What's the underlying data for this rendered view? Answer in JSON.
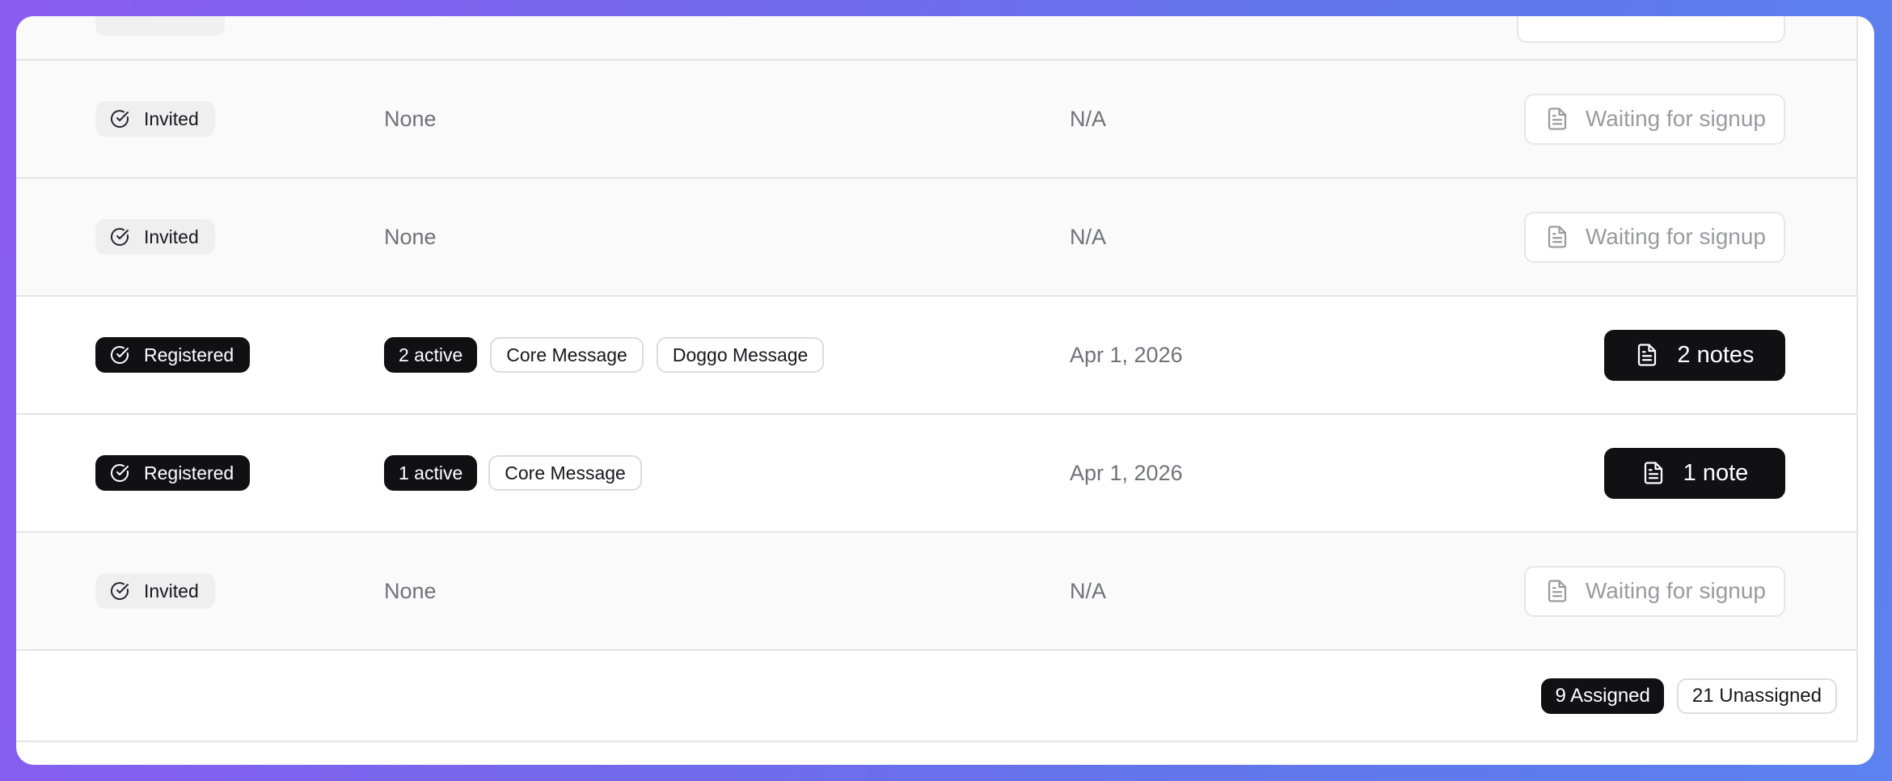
{
  "rows": [
    {
      "status": "Invited",
      "subscriptions": "None",
      "date": "N/A",
      "action": "Waiting for signup"
    },
    {
      "status": "Invited",
      "subscriptions": "None",
      "date": "N/A",
      "action": "Waiting for signup"
    },
    {
      "status": "Registered",
      "active_count": "2 active",
      "messages": [
        "Core Message",
        "Doggo Message"
      ],
      "date": "Apr 1, 2026",
      "action": "2 notes"
    },
    {
      "status": "Registered",
      "active_count": "1 active",
      "messages": [
        "Core Message"
      ],
      "date": "Apr 1, 2026",
      "action": "1 note"
    },
    {
      "status": "Invited",
      "subscriptions": "None",
      "date": "N/A",
      "action": "Waiting for signup"
    }
  ],
  "footer": {
    "assigned": "9 Assigned",
    "unassigned": "21 Unassigned"
  },
  "icons": {
    "status": "circle-check-icon",
    "notes": "file-text-icon"
  }
}
